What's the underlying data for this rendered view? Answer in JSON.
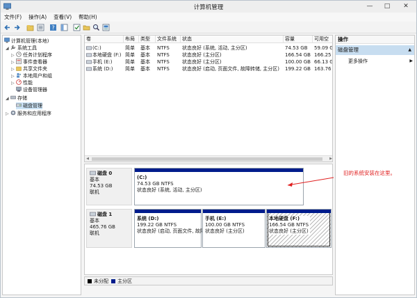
{
  "window": {
    "title": "计算机管理"
  },
  "menu": [
    {
      "label": "文件(F)"
    },
    {
      "label": "操作(A)"
    },
    {
      "label": "查看(V)"
    },
    {
      "label": "帮助(H)"
    }
  ],
  "toolbar_icons": [
    "back-arrow-icon",
    "forward-arrow-icon",
    "folder-up-icon",
    "properties-icon",
    "help-icon",
    "panel-icon",
    "checkmark-icon",
    "open-folder-icon",
    "magnify-icon",
    "view-icon"
  ],
  "tree": {
    "root": "计算机管理(本地)",
    "system_tools": "系统工具",
    "task_scheduler": "任务计划程序",
    "event_viewer": "事件查看器",
    "shared_folders": "共享文件夹",
    "local_users": "本地用户和组",
    "performance": "性能",
    "device_manager": "设备管理器",
    "storage": "存储",
    "disk_management": "磁盘管理",
    "services": "服务和应用程序"
  },
  "volume_list": {
    "columns": [
      "卷",
      "布局",
      "类型",
      "文件系统",
      "状态",
      "容量",
      "可用空"
    ],
    "rows": [
      {
        "volume": "(C:)",
        "layout": "简单",
        "type": "基本",
        "fs": "NTFS",
        "status": "状态良好 (系统, 活动, 主分区)",
        "capacity": "74.53 GB",
        "free": "59.09 G"
      },
      {
        "volume": "本地硬盘 (F:)",
        "layout": "简单",
        "type": "基本",
        "fs": "NTFS",
        "status": "状态良好 (主分区)",
        "capacity": "166.54 GB",
        "free": "166.25"
      },
      {
        "volume": "手机 (E:)",
        "layout": "简单",
        "type": "基本",
        "fs": "NTFS",
        "status": "状态良好 (主分区)",
        "capacity": "100.00 GB",
        "free": "66.13 G"
      },
      {
        "volume": "系统 (D:)",
        "layout": "简单",
        "type": "基本",
        "fs": "NTFS",
        "status": "状态良好 (启动, 页面文件, 故障转储, 主分区)",
        "capacity": "199.22 GB",
        "free": "163.76"
      }
    ]
  },
  "disks": [
    {
      "name": "磁盘 0",
      "kind": "基本",
      "size": "74.53 GB",
      "state": "联机",
      "partitions": [
        {
          "name": "(C:)",
          "detail": "74.53 GB NTFS",
          "status": "状态良好 (系统, 活动, 主分区)"
        }
      ]
    },
    {
      "name": "磁盘 1",
      "kind": "基本",
      "size": "465.76 GB",
      "state": "联机",
      "partitions": [
        {
          "name": "系统  (D:)",
          "detail": "199.22 GB NTFS",
          "status": "状态良好 (启动, 页面文件, 故障"
        },
        {
          "name": "手机  (E:)",
          "detail": "100.00 GB NTFS",
          "status": "状态良好 (主分区)"
        },
        {
          "name": "本地硬盘  (F:)",
          "detail": "166.54 GB NTFS",
          "status": "状态良好 (主分区)"
        }
      ]
    }
  ],
  "legend": [
    {
      "label": "未分配",
      "color": "#000000"
    },
    {
      "label": "主分区",
      "color": "#001c8c"
    }
  ],
  "actions": {
    "header": "操作",
    "section": "磁盘管理",
    "more": "更多操作"
  },
  "annotation": {
    "text": "旧的系统安装在这里。",
    "color": "#e01f1f"
  }
}
